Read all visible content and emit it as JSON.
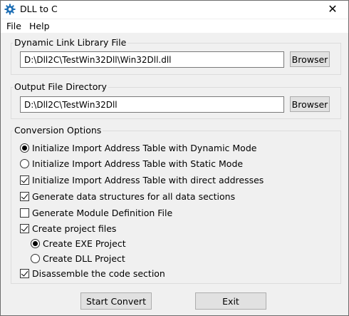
{
  "window": {
    "title": "DLL to C",
    "close_glyph": "✕",
    "icon": "gear-icon"
  },
  "menu": [
    "File",
    "Help"
  ],
  "dll_group": {
    "legend": "Dynamic Link Library File",
    "path": "D:\\Dll2C\\TestWin32Dll\\Win32Dll.dll",
    "browse_label": "Browser"
  },
  "output_group": {
    "legend": "Output File Directory",
    "path": "D:\\Dll2C\\TestWin32Dll",
    "browse_label": "Browser"
  },
  "options": {
    "legend": "Conversion Options",
    "items": [
      {
        "label": "Initialize Import Address Table with Dynamic Mode",
        "kind": "radio",
        "checked": true
      },
      {
        "label": "Initialize Import Address Table with Static Mode",
        "kind": "radio",
        "checked": false
      },
      {
        "label": "Initialize Import Address Table with direct addresses",
        "kind": "checkbox",
        "checked": true
      },
      {
        "label": "Generate data structures for all data sections",
        "kind": "checkbox",
        "checked": true
      },
      {
        "label": "Generate Module Definition File",
        "kind": "checkbox",
        "checked": false
      },
      {
        "label": "Create project files",
        "kind": "checkbox",
        "checked": true
      },
      {
        "label": "Create EXE Project",
        "kind": "radio",
        "checked": true
      },
      {
        "label": "Create DLL Project",
        "kind": "radio",
        "checked": false
      },
      {
        "label": "Disassemble the code section",
        "kind": "checkbox",
        "checked": true
      }
    ]
  },
  "buttons": {
    "start": "Start Convert",
    "exit": "Exit"
  }
}
